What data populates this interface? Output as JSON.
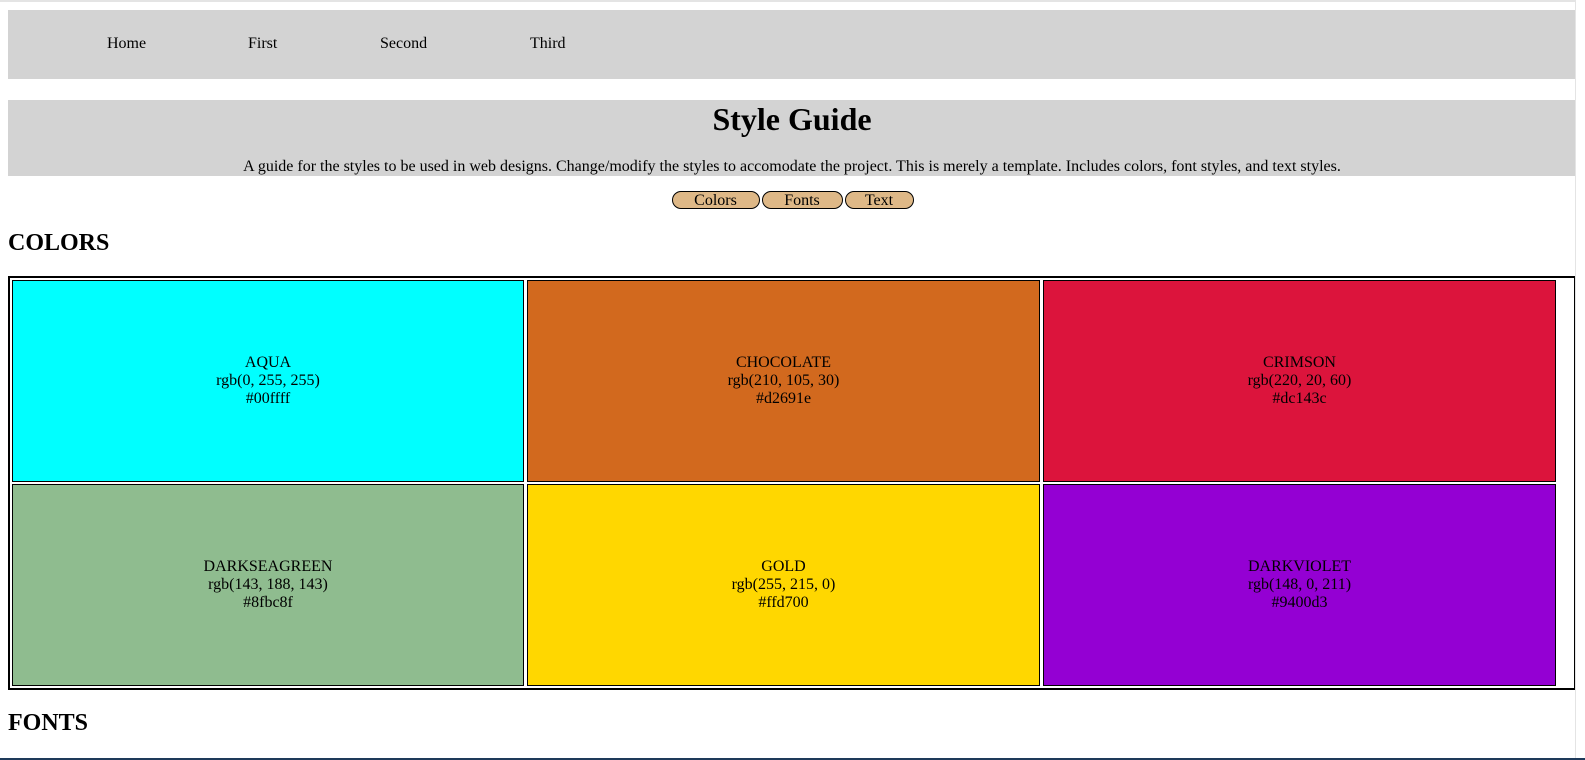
{
  "nav": {
    "items": [
      "Home",
      "First",
      "Second",
      "Third"
    ]
  },
  "header": {
    "title": "Style Guide",
    "description": "A guide for the styles to be used in web designs. Change/modify the styles to accomodate the project. This is merely a template. Includes colors, font styles, and text styles."
  },
  "buttons": [
    "Colors",
    "Fonts",
    "Text"
  ],
  "sections": {
    "colors_heading": "COLORS",
    "fonts_heading": "FONTS"
  },
  "colors": [
    {
      "name": "AQUA",
      "rgb": "rgb(0, 255, 255)",
      "hex": "#00ffff"
    },
    {
      "name": "CHOCOLATE",
      "rgb": "rgb(210, 105, 30)",
      "hex": "#d2691e"
    },
    {
      "name": "CRIMSON",
      "rgb": "rgb(220, 20, 60)",
      "hex": "#dc143c"
    },
    {
      "name": "DARKSEAGREEN",
      "rgb": "rgb(143, 188, 143)",
      "hex": "#8fbc8f"
    },
    {
      "name": "GOLD",
      "rgb": "rgb(255, 215, 0)",
      "hex": "#ffd700"
    },
    {
      "name": "DARKVIOLET",
      "rgb": "rgb(148, 0, 211)",
      "hex": "#9400d3"
    }
  ],
  "theme": {
    "panel_bg": "#d3d3d3",
    "button_bg": "#deb887"
  }
}
